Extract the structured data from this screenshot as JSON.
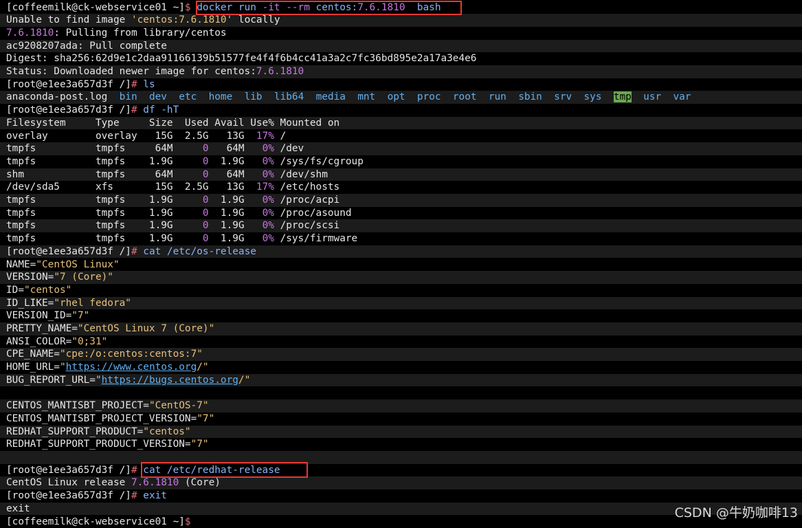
{
  "colors": {
    "background": "#000000",
    "text": "#e6e6e6",
    "prompt_symbol": "#e06c75",
    "command": "#8ab4f8",
    "flag": "#c678dd",
    "string": "#e5c07b",
    "number": "#c678dd",
    "directory": "#61afef",
    "highlight_box": "#e53935",
    "tmp_background": "#6aa84f"
  },
  "watermark": "CSDN @牛奶咖啡13",
  "lines": [
    [
      {
        "t": "[coffeemilk@ck-webservice01 ~]",
        "c": "prompt"
      },
      {
        "t": "$ ",
        "c": "dollar"
      },
      {
        "t": "docker run ",
        "c": "cmd"
      },
      {
        "t": "-it --rm",
        "c": "flag"
      },
      {
        "t": " centos:",
        "c": "cmd"
      },
      {
        "t": "7.6.1810",
        "c": "num"
      },
      {
        "t": "  bash",
        "c": "cmd"
      }
    ],
    [
      {
        "t": "Unable to find image ",
        "c": "prompt"
      },
      {
        "t": "'centos:7.6.1810'",
        "c": "str"
      },
      {
        "t": " locally",
        "c": "prompt"
      }
    ],
    [
      {
        "t": "7.6.1810",
        "c": "num"
      },
      {
        "t": ": Pulling from library/centos",
        "c": "prompt"
      }
    ],
    [
      {
        "t": "ac9208207ada: Pull complete",
        "c": "prompt"
      }
    ],
    [
      {
        "t": "Digest: sha256:62d9e1c2daa91166139b51577fe4f4f6b4cc41a3a2c7fc36bd895e2a17a3e4e6",
        "c": "prompt"
      }
    ],
    [
      {
        "t": "Status: Downloaded newer image for centos:",
        "c": "prompt"
      },
      {
        "t": "7.6.1810",
        "c": "num"
      }
    ],
    [
      {
        "t": "[root@e1ee3a657d3f /]",
        "c": "prompt"
      },
      {
        "t": "# ",
        "c": "hash"
      },
      {
        "t": "ls",
        "c": "cmd"
      }
    ],
    [
      {
        "t": "anaconda-post.log  ",
        "c": "prompt"
      },
      {
        "t": "bin",
        "c": "dir"
      },
      {
        "t": "  ",
        "c": "prompt"
      },
      {
        "t": "dev",
        "c": "dir"
      },
      {
        "t": "  ",
        "c": "prompt"
      },
      {
        "t": "etc",
        "c": "dir"
      },
      {
        "t": "  ",
        "c": "prompt"
      },
      {
        "t": "home",
        "c": "dir"
      },
      {
        "t": "  ",
        "c": "prompt"
      },
      {
        "t": "lib",
        "c": "dir"
      },
      {
        "t": "  ",
        "c": "prompt"
      },
      {
        "t": "lib64",
        "c": "dir"
      },
      {
        "t": "  ",
        "c": "prompt"
      },
      {
        "t": "media",
        "c": "dir"
      },
      {
        "t": "  ",
        "c": "prompt"
      },
      {
        "t": "mnt",
        "c": "dir"
      },
      {
        "t": "  ",
        "c": "prompt"
      },
      {
        "t": "opt",
        "c": "dir"
      },
      {
        "t": "  ",
        "c": "prompt"
      },
      {
        "t": "proc",
        "c": "dir"
      },
      {
        "t": "  ",
        "c": "prompt"
      },
      {
        "t": "root",
        "c": "dir"
      },
      {
        "t": "  ",
        "c": "prompt"
      },
      {
        "t": "run",
        "c": "dir"
      },
      {
        "t": "  ",
        "c": "prompt"
      },
      {
        "t": "sbin",
        "c": "dir"
      },
      {
        "t": "  ",
        "c": "prompt"
      },
      {
        "t": "srv",
        "c": "dir"
      },
      {
        "t": "  ",
        "c": "prompt"
      },
      {
        "t": "sys",
        "c": "dir"
      },
      {
        "t": "  ",
        "c": "prompt"
      },
      {
        "t": "tmp",
        "c": "tmp"
      },
      {
        "t": "  ",
        "c": "prompt"
      },
      {
        "t": "usr",
        "c": "dir"
      },
      {
        "t": "  ",
        "c": "prompt"
      },
      {
        "t": "var",
        "c": "dir"
      }
    ],
    [
      {
        "t": "[root@e1ee3a657d3f /]",
        "c": "prompt"
      },
      {
        "t": "# ",
        "c": "hash"
      },
      {
        "t": "df -hT",
        "c": "cmd"
      }
    ],
    [
      {
        "t": "Filesystem     Type     Size  Used Avail Use% Mounted on",
        "c": "prompt"
      }
    ],
    [
      {
        "t": "overlay        overlay   15G  2.5G   13G  ",
        "c": "prompt"
      },
      {
        "t": "17%",
        "c": "num"
      },
      {
        "t": " /",
        "c": "prompt"
      }
    ],
    [
      {
        "t": "tmpfs          tmpfs     64M     ",
        "c": "prompt"
      },
      {
        "t": "0",
        "c": "num"
      },
      {
        "t": "   64M   ",
        "c": "prompt"
      },
      {
        "t": "0%",
        "c": "num"
      },
      {
        "t": " /dev",
        "c": "prompt"
      }
    ],
    [
      {
        "t": "tmpfs          tmpfs    1.9G     ",
        "c": "prompt"
      },
      {
        "t": "0",
        "c": "num"
      },
      {
        "t": "  1.9G   ",
        "c": "prompt"
      },
      {
        "t": "0%",
        "c": "num"
      },
      {
        "t": " /sys/fs/cgroup",
        "c": "prompt"
      }
    ],
    [
      {
        "t": "shm            tmpfs     64M     ",
        "c": "prompt"
      },
      {
        "t": "0",
        "c": "num"
      },
      {
        "t": "   64M   ",
        "c": "prompt"
      },
      {
        "t": "0%",
        "c": "num"
      },
      {
        "t": " /dev/shm",
        "c": "prompt"
      }
    ],
    [
      {
        "t": "/dev/sda5      xfs       15G  2.5G   13G  ",
        "c": "prompt"
      },
      {
        "t": "17%",
        "c": "num"
      },
      {
        "t": " /etc/hosts",
        "c": "prompt"
      }
    ],
    [
      {
        "t": "tmpfs          tmpfs    1.9G     ",
        "c": "prompt"
      },
      {
        "t": "0",
        "c": "num"
      },
      {
        "t": "  1.9G   ",
        "c": "prompt"
      },
      {
        "t": "0%",
        "c": "num"
      },
      {
        "t": " /proc/acpi",
        "c": "prompt"
      }
    ],
    [
      {
        "t": "tmpfs          tmpfs    1.9G     ",
        "c": "prompt"
      },
      {
        "t": "0",
        "c": "num"
      },
      {
        "t": "  1.9G   ",
        "c": "prompt"
      },
      {
        "t": "0%",
        "c": "num"
      },
      {
        "t": " /proc/asound",
        "c": "prompt"
      }
    ],
    [
      {
        "t": "tmpfs          tmpfs    1.9G     ",
        "c": "prompt"
      },
      {
        "t": "0",
        "c": "num"
      },
      {
        "t": "  1.9G   ",
        "c": "prompt"
      },
      {
        "t": "0%",
        "c": "num"
      },
      {
        "t": " /proc/scsi",
        "c": "prompt"
      }
    ],
    [
      {
        "t": "tmpfs          tmpfs    1.9G     ",
        "c": "prompt"
      },
      {
        "t": "0",
        "c": "num"
      },
      {
        "t": "  1.9G   ",
        "c": "prompt"
      },
      {
        "t": "0%",
        "c": "num"
      },
      {
        "t": " /sys/firmware",
        "c": "prompt"
      }
    ],
    [
      {
        "t": "[root@e1ee3a657d3f /]",
        "c": "prompt"
      },
      {
        "t": "# ",
        "c": "hash"
      },
      {
        "t": "cat /etc/os-release",
        "c": "cmd"
      }
    ],
    [
      {
        "t": "NAME=",
        "c": "prompt"
      },
      {
        "t": "\"CentOS Linux\"",
        "c": "str"
      }
    ],
    [
      {
        "t": "VERSION=",
        "c": "prompt"
      },
      {
        "t": "\"7 (Core)\"",
        "c": "str"
      }
    ],
    [
      {
        "t": "ID=",
        "c": "prompt"
      },
      {
        "t": "\"centos\"",
        "c": "str"
      }
    ],
    [
      {
        "t": "ID_LIKE=",
        "c": "prompt"
      },
      {
        "t": "\"rhel fedora\"",
        "c": "str"
      }
    ],
    [
      {
        "t": "VERSION_ID=",
        "c": "prompt"
      },
      {
        "t": "\"7\"",
        "c": "str"
      }
    ],
    [
      {
        "t": "PRETTY_NAME=",
        "c": "prompt"
      },
      {
        "t": "\"CentOS Linux 7 (Core)\"",
        "c": "str"
      }
    ],
    [
      {
        "t": "ANSI_COLOR=",
        "c": "prompt"
      },
      {
        "t": "\"0;31\"",
        "c": "str"
      }
    ],
    [
      {
        "t": "CPE_NAME=",
        "c": "prompt"
      },
      {
        "t": "\"cpe:/o:centos:centos:7\"",
        "c": "str"
      }
    ],
    [
      {
        "t": "HOME_URL=",
        "c": "prompt"
      },
      {
        "t": "\"",
        "c": "str"
      },
      {
        "t": "https://www.centos.org",
        "c": "link"
      },
      {
        "t": "/\"",
        "c": "str"
      }
    ],
    [
      {
        "t": "BUG_REPORT_URL=",
        "c": "prompt"
      },
      {
        "t": "\"",
        "c": "str"
      },
      {
        "t": "https://bugs.centos.org",
        "c": "link"
      },
      {
        "t": "/\"",
        "c": "str"
      }
    ],
    [],
    [
      {
        "t": "CENTOS_MANTISBT_PROJECT=",
        "c": "prompt"
      },
      {
        "t": "\"CentOS-7\"",
        "c": "str"
      }
    ],
    [
      {
        "t": "CENTOS_MANTISBT_PROJECT_VERSION=",
        "c": "prompt"
      },
      {
        "t": "\"7\"",
        "c": "str"
      }
    ],
    [
      {
        "t": "REDHAT_SUPPORT_PRODUCT=",
        "c": "prompt"
      },
      {
        "t": "\"centos\"",
        "c": "str"
      }
    ],
    [
      {
        "t": "REDHAT_SUPPORT_PRODUCT_VERSION=",
        "c": "prompt"
      },
      {
        "t": "\"7\"",
        "c": "str"
      }
    ],
    [],
    [
      {
        "t": "[root@e1ee3a657d3f /]",
        "c": "prompt"
      },
      {
        "t": "# ",
        "c": "hash"
      },
      {
        "t": "cat /etc/redhat-release",
        "c": "cmd"
      }
    ],
    [
      {
        "t": "CentOS Linux release ",
        "c": "prompt"
      },
      {
        "t": "7.6.1810",
        "c": "num"
      },
      {
        "t": " (Core)",
        "c": "prompt"
      }
    ],
    [
      {
        "t": "[root@e1ee3a657d3f /]",
        "c": "prompt"
      },
      {
        "t": "# ",
        "c": "hash"
      },
      {
        "t": "exit",
        "c": "cmd"
      }
    ],
    [
      {
        "t": "exit",
        "c": "prompt"
      }
    ],
    [
      {
        "t": "[coffeemilk@ck-webservice01 ~]",
        "c": "prompt"
      },
      {
        "t": "$",
        "c": "dollar"
      }
    ]
  ]
}
